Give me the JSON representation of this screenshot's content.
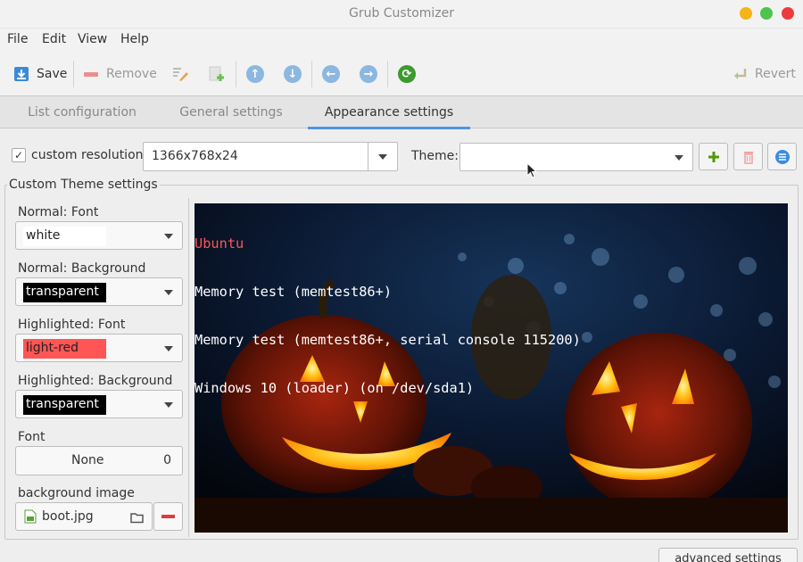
{
  "window": {
    "title": "Grub Customizer"
  },
  "menu": [
    "File",
    "Edit",
    "View",
    "Help"
  ],
  "toolbar": {
    "save": "Save",
    "remove": "Remove",
    "revert": "Revert"
  },
  "tabs": [
    "List configuration",
    "General settings",
    "Appearance settings"
  ],
  "active_tab": "Appearance settings",
  "resolution": {
    "checkbox_label": "custom resolution:",
    "checked": true,
    "value": "1366x768x24"
  },
  "theme": {
    "label": "Theme:",
    "value": ""
  },
  "custom_theme": {
    "title": "Custom Theme settings",
    "normal_font_label": "Normal: Font",
    "normal_font_value": "white",
    "normal_bg_label": "Normal: Background",
    "normal_bg_value": "transparent",
    "hl_font_label": "Highlighted: Font",
    "hl_font_value": "light-red",
    "hl_bg_label": "Highlighted: Background",
    "hl_bg_value": "transparent",
    "font_label": "Font",
    "font_name": "None",
    "font_size": "0",
    "bg_image_label": "background image",
    "bg_image_file": "boot.jpg"
  },
  "preview": {
    "entries": [
      "Ubuntu",
      "Memory test (memtest86+)",
      "Memory test (memtest86+, serial console 115200)",
      "Windows 10 (loader) (on /dev/sda1)"
    ],
    "selected_index": 0
  },
  "advanced_button": "advanced settings",
  "colors": {
    "accent": "#5294e2",
    "light_red": "#ff5555",
    "swatch_white": "#ffffff",
    "swatch_black": "#000000"
  }
}
